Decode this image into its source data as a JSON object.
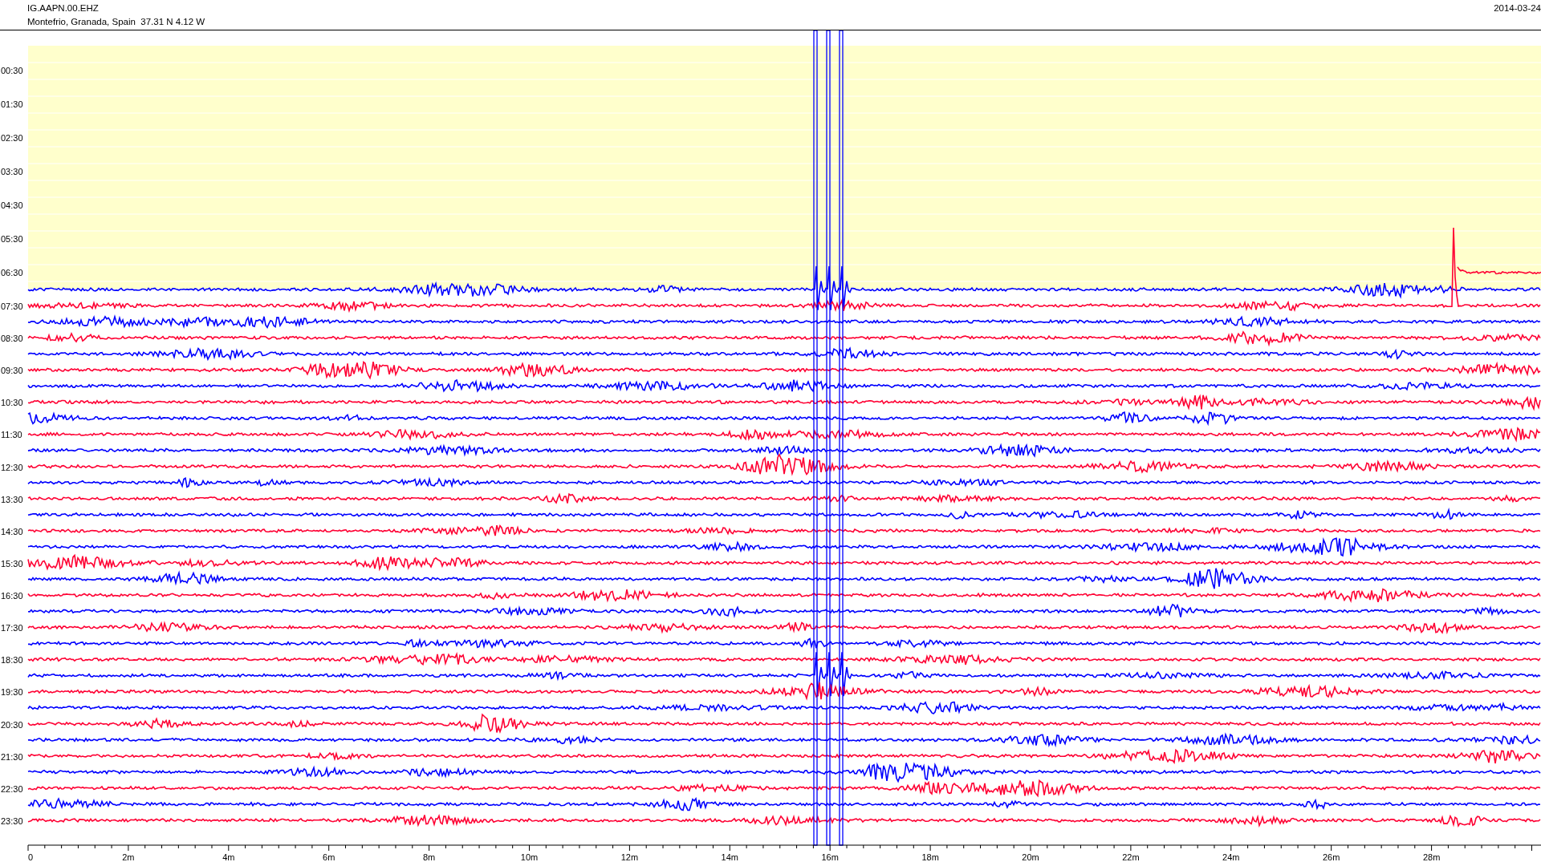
{
  "header": {
    "station": "IG.AAPN.00.EHZ",
    "location": "Montefrio, Granada, Spain  37.31 N 4.12 W",
    "date": "2014-03-24"
  },
  "time_labels": [
    "00:30",
    "01:30",
    "02:30",
    "03:30",
    "04:30",
    "05:30",
    "06:30",
    "07:30",
    "08:30",
    "09:30",
    "10:30",
    "11:30",
    "12:30",
    "13:30",
    "14:30",
    "15:30",
    "16:30",
    "17:30",
    "18:30",
    "19:30",
    "20:30",
    "21:30",
    "22:30",
    "23:30"
  ],
  "x_tick_labels": [
    "0",
    "2m",
    "4m",
    "6m",
    "8m",
    "10m",
    "12m",
    "14m",
    "16m",
    "18m",
    "20m",
    "22m",
    "24m",
    "26m",
    "28m"
  ],
  "traces": [
    {
      "color": "#0000ff"
    },
    {
      "color": "#ff0033"
    },
    {
      "color": "#0000ff"
    },
    {
      "color": "#ff0033"
    },
    {
      "color": "#0000ff"
    },
    {
      "color": "#ff0033"
    },
    {
      "color": "#0000ff"
    },
    {
      "color": "#ff0033"
    },
    {
      "color": "#0000ff"
    },
    {
      "color": "#ff0033"
    },
    {
      "color": "#0000ff"
    },
    {
      "color": "#ff0033"
    },
    {
      "color": "#0000ff"
    },
    {
      "color": "#ff0033"
    },
    {
      "color": "#0000ff"
    },
    {
      "color": "#ff0033"
    },
    {
      "color": "#0000ff"
    },
    {
      "color": "#ff0033"
    },
    {
      "color": "#0000ff"
    },
    {
      "color": "#ff0033"
    },
    {
      "color": "#0000ff"
    },
    {
      "color": "#ff0033"
    },
    {
      "color": "#0000ff"
    },
    {
      "color": "#ff0033"
    },
    {
      "color": "#0000ff"
    },
    {
      "color": "#ff0033"
    },
    {
      "color": "#0000ff"
    },
    {
      "color": "#ff0033"
    },
    {
      "color": "#0000ff"
    },
    {
      "color": "#ff0033"
    },
    {
      "color": "#0000ff"
    },
    {
      "color": "#ff0033"
    },
    {
      "color": "#0000ff"
    },
    {
      "color": "#ff0033"
    }
  ]
}
